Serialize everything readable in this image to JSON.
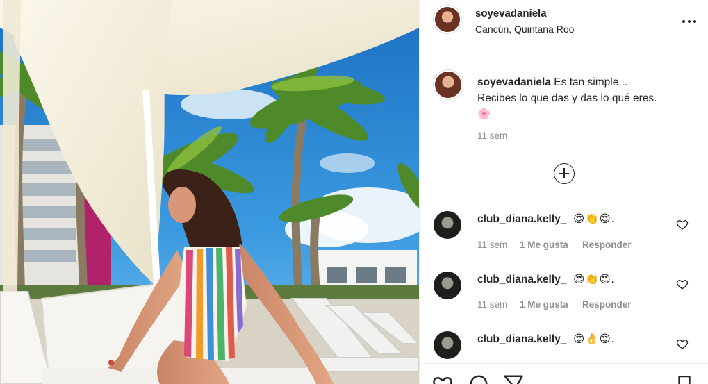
{
  "post": {
    "owner": {
      "username": "soyevadaniela",
      "location": "Cancún, Quintana Roo",
      "avatar_icon": "profile-avatar"
    },
    "more_icon": "more-options-icon",
    "caption": {
      "username": "soyevadaniela",
      "line1": "Es tan simple...",
      "line2": "Recibes lo que das y das lo qué eres.",
      "emoji": "🌸",
      "age": "11 sem"
    },
    "load_more_icon": "plus-circle-icon",
    "comments": [
      {
        "username": "club_diana.kelly_",
        "text": "😍👏😍.",
        "age": "11 sem",
        "likes": "1 Me gusta",
        "reply": "Responder"
      },
      {
        "username": "club_diana.kelly_",
        "text": "😍👏😍.",
        "age": "11 sem",
        "likes": "1 Me gusta",
        "reply": "Responder"
      },
      {
        "username": "club_diana.kelly_",
        "text": "😍👌😍."
      }
    ],
    "actions": [
      "heart-icon",
      "comment-icon",
      "share-icon",
      "save-icon"
    ]
  },
  "colors": {
    "text": "#262626",
    "muted": "#8e8e8e",
    "border": "#efefef",
    "sky": "#2b8ad4"
  }
}
